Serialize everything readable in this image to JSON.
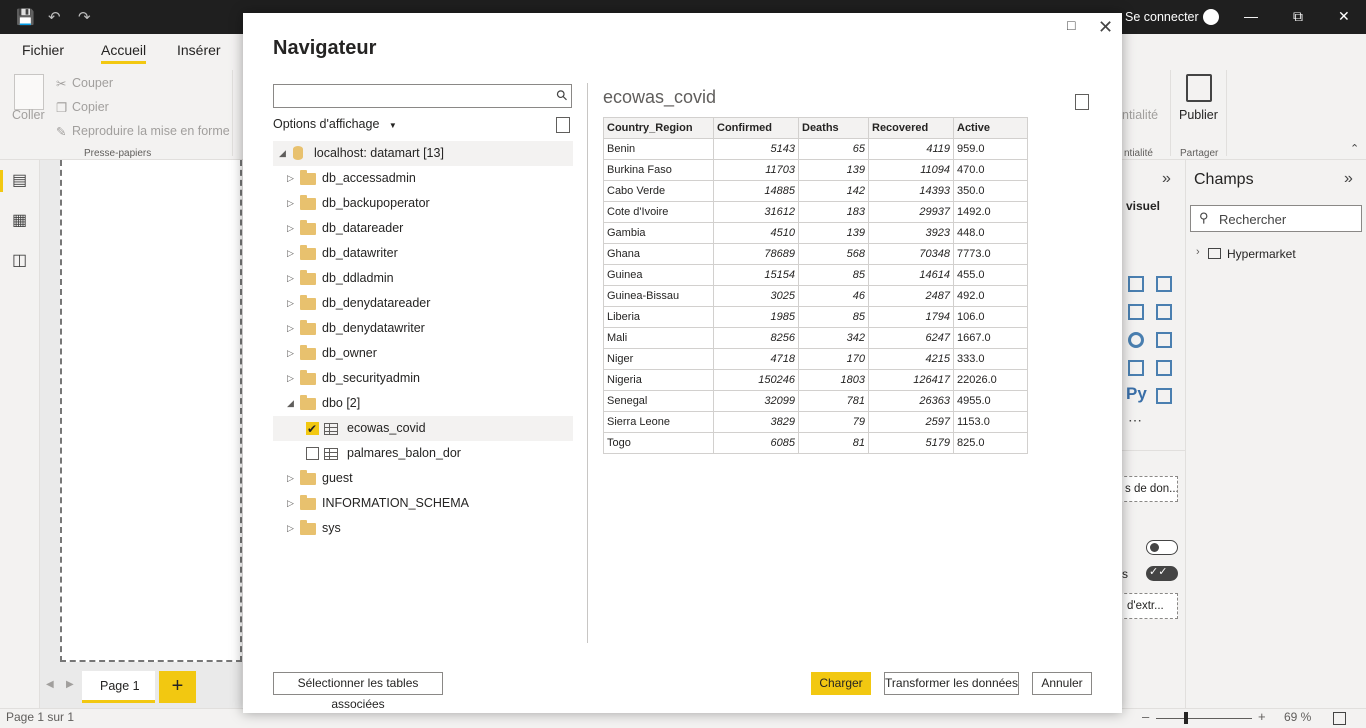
{
  "app": {
    "signin_label": "Se connecter"
  },
  "ribbon": {
    "tabs": [
      "Fichier",
      "Accueil",
      "Insérer"
    ],
    "paste_label": "Coller",
    "cut_label": "Couper",
    "copy_label": "Copier",
    "format_painter_label": "Reproduire la mise en forme",
    "clipboard_group": "Presse-papiers",
    "sensitivity_label": "ntialité",
    "sensitivity_group": "ntialité",
    "publish_label": "Publier",
    "share_group": "Partager"
  },
  "right_panel": {
    "visual_label": "visuel",
    "fields_title": "Champs",
    "search_placeholder": "Rechercher",
    "table_item": "Hypermarket",
    "data_button_fragment": "s de don...",
    "toggle_label_fragment": "s",
    "extract_button_fragment": "d'extr..."
  },
  "pages": {
    "tab_label": "Page 1",
    "status": "Page 1 sur 1",
    "zoom": "69 %"
  },
  "dialog": {
    "title": "Navigateur",
    "display_options": "Options d'affichage",
    "tree_root": "localhost: datamart [13]",
    "tree_items": [
      {
        "label": "db_accessadmin",
        "type": "folder",
        "level": 1,
        "expanded": false
      },
      {
        "label": "db_backupoperator",
        "type": "folder",
        "level": 1,
        "expanded": false
      },
      {
        "label": "db_datareader",
        "type": "folder",
        "level": 1,
        "expanded": false
      },
      {
        "label": "db_datawriter",
        "type": "folder",
        "level": 1,
        "expanded": false
      },
      {
        "label": "db_ddladmin",
        "type": "folder",
        "level": 1,
        "expanded": false
      },
      {
        "label": "db_denydatareader",
        "type": "folder",
        "level": 1,
        "expanded": false
      },
      {
        "label": "db_denydatawriter",
        "type": "folder",
        "level": 1,
        "expanded": false
      },
      {
        "label": "db_owner",
        "type": "folder",
        "level": 1,
        "expanded": false
      },
      {
        "label": "db_securityadmin",
        "type": "folder",
        "level": 1,
        "expanded": false
      },
      {
        "label": "dbo [2]",
        "type": "folder",
        "level": 1,
        "expanded": true
      },
      {
        "label": "ecowas_covid",
        "type": "table",
        "level": 2,
        "checked": true
      },
      {
        "label": "palmares_balon_dor",
        "type": "table",
        "level": 2,
        "checked": false
      },
      {
        "label": "guest",
        "type": "folder",
        "level": 1,
        "expanded": false
      },
      {
        "label": "INFORMATION_SCHEMA",
        "type": "folder",
        "level": 1,
        "expanded": false
      },
      {
        "label": "sys",
        "type": "folder",
        "level": 1,
        "expanded": false
      }
    ],
    "preview_title": "ecowas_covid",
    "columns": [
      "Country_Region",
      "Confirmed",
      "Deaths",
      "Recovered",
      "Active"
    ],
    "rows": [
      [
        "Benin",
        "5143",
        "65",
        "4119",
        "959.0"
      ],
      [
        "Burkina Faso",
        "11703",
        "139",
        "11094",
        "470.0"
      ],
      [
        "Cabo Verde",
        "14885",
        "142",
        "14393",
        "350.0"
      ],
      [
        "Cote d'Ivoire",
        "31612",
        "183",
        "29937",
        "1492.0"
      ],
      [
        "Gambia",
        "4510",
        "139",
        "3923",
        "448.0"
      ],
      [
        "Ghana",
        "78689",
        "568",
        "70348",
        "7773.0"
      ],
      [
        "Guinea",
        "15154",
        "85",
        "14614",
        "455.0"
      ],
      [
        "Guinea-Bissau",
        "3025",
        "46",
        "2487",
        "492.0"
      ],
      [
        "Liberia",
        "1985",
        "85",
        "1794",
        "106.0"
      ],
      [
        "Mali",
        "8256",
        "342",
        "6247",
        "1667.0"
      ],
      [
        "Niger",
        "4718",
        "170",
        "4215",
        "333.0"
      ],
      [
        "Nigeria",
        "150246",
        "1803",
        "126417",
        "22026.0"
      ],
      [
        "Senegal",
        "32099",
        "781",
        "26363",
        "4955.0"
      ],
      [
        "Sierra Leone",
        "3829",
        "79",
        "2597",
        "1153.0"
      ],
      [
        "Togo",
        "6085",
        "81",
        "5179",
        "825.0"
      ]
    ],
    "select_related_button": "Sélectionner les tables associées",
    "load_button": "Charger",
    "transform_button": "Transformer les données",
    "cancel_button": "Annuler"
  },
  "colors": {
    "accent": "#f2c811",
    "titlebar": "#1f1f1f"
  }
}
